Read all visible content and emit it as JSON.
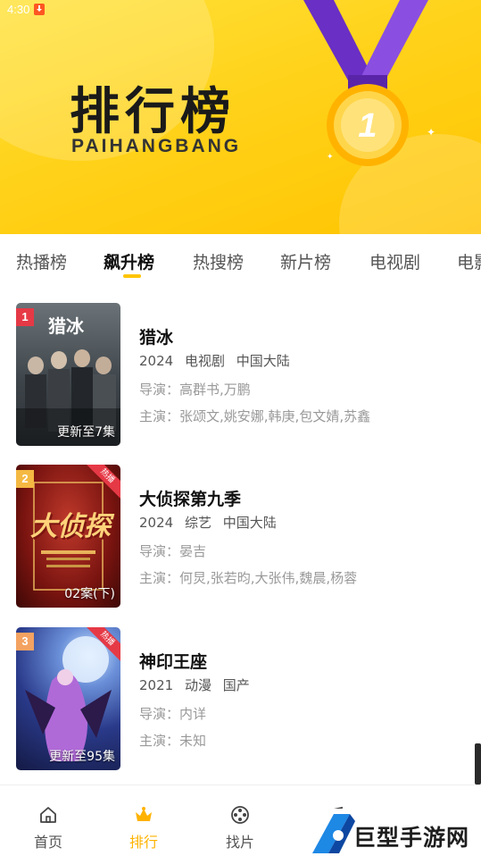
{
  "status_bar": {
    "time": "4:30"
  },
  "banner": {
    "title": "排行榜",
    "subtitle": "PAIHANGBANG",
    "medal_number": "1",
    "colors": {
      "background": "#ffd21a",
      "ribbon": "#7b3fd4",
      "medal": "#ffb300"
    }
  },
  "tabs": [
    {
      "label": "热播榜",
      "active": false
    },
    {
      "label": "飙升榜",
      "active": true
    },
    {
      "label": "热搜榜",
      "active": false
    },
    {
      "label": "新片榜",
      "active": false
    },
    {
      "label": "电视剧",
      "active": false
    },
    {
      "label": "电影",
      "active": false
    }
  ],
  "items": [
    {
      "rank": "1",
      "rank_color": "#e63946",
      "poster_title": "猎冰",
      "poster_caption": "更新至7集",
      "title": "猎冰",
      "year": "2024",
      "type": "电视剧",
      "region": "中国大陆",
      "director_label": "导演：",
      "director": "高群书,万鹏",
      "cast_label": "主演：",
      "cast": "张颂文,姚安娜,韩庚,包文婧,苏鑫"
    },
    {
      "rank": "2",
      "rank_color": "#f4b942",
      "poster_title": "大侦探",
      "poster_caption": "02案(下)",
      "hot_tag": "热播",
      "title": "大侦探第九季",
      "year": "2024",
      "type": "综艺",
      "region": "中国大陆",
      "director_label": "导演：",
      "director": "晏吉",
      "cast_label": "主演：",
      "cast": "何炅,张若昀,大张伟,魏晨,杨蓉"
    },
    {
      "rank": "3",
      "rank_color": "#f4a261",
      "poster_caption": "更新至95集",
      "hot_tag": "热播",
      "title": "神印王座",
      "year": "2021",
      "type": "动漫",
      "region": "国产",
      "director_label": "导演：",
      "director": "内详",
      "cast_label": "主演：",
      "cast": "未知"
    }
  ],
  "bottom_nav": [
    {
      "label": "首页",
      "icon": "home-icon",
      "active": false
    },
    {
      "label": "排行",
      "icon": "crown-icon",
      "active": true
    },
    {
      "label": "找片",
      "icon": "film-reel-icon",
      "active": false
    },
    {
      "label": "",
      "icon": "music-note-icon",
      "active": false
    },
    {
      "label": "",
      "icon": "profile-icon",
      "active": false
    }
  ],
  "watermark": {
    "text": "巨型手游网"
  }
}
